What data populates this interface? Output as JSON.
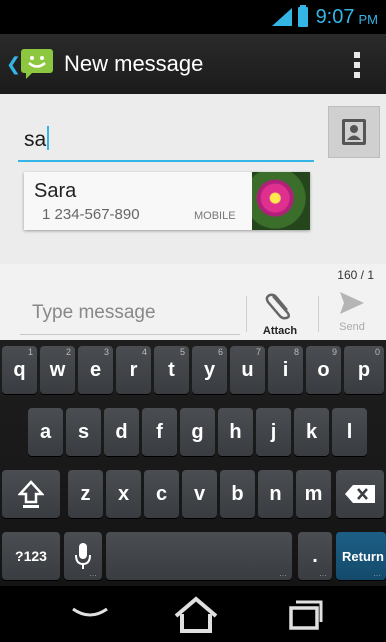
{
  "status_bar": {
    "time": "9:07",
    "ampm": "PM",
    "accent_color": "#33b5e5"
  },
  "action_bar": {
    "title": "New message",
    "app_icon": "message-smiley-icon",
    "overflow_icon": "overflow-menu-icon"
  },
  "recipient": {
    "value": "sa",
    "contact_picker_icon": "contact-card-icon",
    "suggestion": {
      "name": "Sara",
      "number": "1 234-567-890",
      "type": "MOBILE",
      "photo": "flower-photo"
    }
  },
  "compose": {
    "counter": "160 / 1",
    "placeholder": "Type message",
    "attach_label": "Attach",
    "send_label": "Send"
  },
  "keyboard": {
    "row1": [
      {
        "label": "q",
        "hint": "1"
      },
      {
        "label": "w",
        "hint": "2"
      },
      {
        "label": "e",
        "hint": "3"
      },
      {
        "label": "r",
        "hint": "4"
      },
      {
        "label": "t",
        "hint": "5"
      },
      {
        "label": "y",
        "hint": "6"
      },
      {
        "label": "u",
        "hint": "7"
      },
      {
        "label": "i",
        "hint": "8"
      },
      {
        "label": "o",
        "hint": "9"
      },
      {
        "label": "p",
        "hint": "0"
      }
    ],
    "row2": [
      "a",
      "s",
      "d",
      "f",
      "g",
      "h",
      "j",
      "k",
      "l"
    ],
    "row3": [
      "z",
      "x",
      "c",
      "v",
      "b",
      "n",
      "m"
    ],
    "symbols_label": "?123",
    "period_label": ".",
    "return_label": "Return",
    "shift_icon": "shift-icon",
    "backspace_icon": "backspace-icon",
    "mic_icon": "microphone-icon"
  },
  "nav_bar": {
    "back_icon": "back-icon",
    "home_icon": "home-icon",
    "recents_icon": "recent-apps-icon"
  }
}
